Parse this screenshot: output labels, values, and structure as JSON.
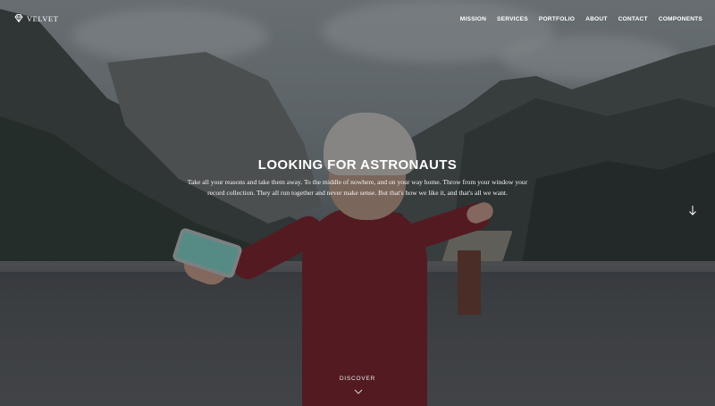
{
  "header": {
    "brand": "VELVET",
    "brand_icon": "diamond-icon",
    "nav_items": [
      {
        "label": "MISSION"
      },
      {
        "label": "SERVICES"
      },
      {
        "label": "PORTFOLIO"
      },
      {
        "label": "ABOUT"
      },
      {
        "label": "CONTACT"
      },
      {
        "label": "COMPONENTS"
      }
    ]
  },
  "hero": {
    "title": "LOOKING FOR ASTRONAUTS",
    "text": "Take all your reasons and take them away. To the middle of nowhere, and on your way home. Throw from your window your record collection. They all run together and never make sense. But that's how we like it, and that's all we want.",
    "scroll_icon": "arrow-down-icon",
    "discover_label": "DISCOVER",
    "discover_icon": "chevron-down-icon"
  },
  "colors": {
    "overlay": "#14181c",
    "text": "#ffffff"
  }
}
